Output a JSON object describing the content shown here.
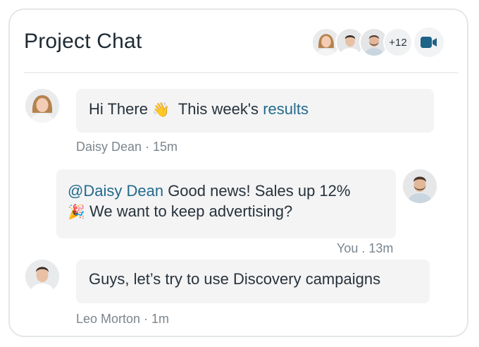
{
  "header": {
    "title": "Project Chat",
    "members_more": "+12",
    "video_icon": "video-camera-icon",
    "accent_color": "#1d6287"
  },
  "messages": [
    {
      "text_before": "Hi There",
      "emoji": "👋",
      "text_middle": "This week's",
      "link_text": "results",
      "author": "Daisy Dean",
      "time": "15m",
      "meta": "Daisy Dean · 15m"
    },
    {
      "mention": "@Daisy Dean",
      "line1_rest": "Good news! Sales up 12%",
      "emoji": "🎉",
      "line2": "We want to keep advertising?",
      "meta": "You . 13m"
    },
    {
      "text": "Guys, let’s try to use Discovery campaigns",
      "meta": "Leo Morton · 1m"
    }
  ]
}
